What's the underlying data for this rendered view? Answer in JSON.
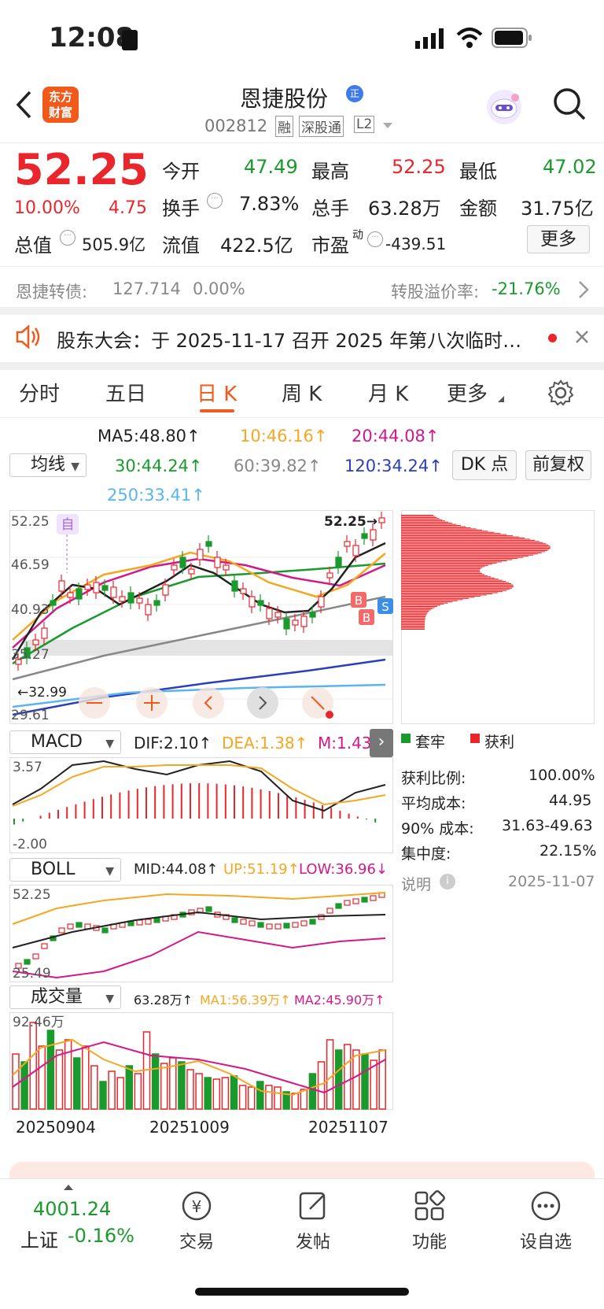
{
  "status": {
    "time": "12:08"
  },
  "header": {
    "logo_line1": "东方",
    "logo_line2": "财富",
    "name": "恩捷股份",
    "badge": "正",
    "code": "002812",
    "tags": [
      "融",
      "深股通",
      "L2"
    ]
  },
  "quote": {
    "price": "52.25",
    "pct": "10.00%",
    "change": "4.75",
    "open_label": "今开",
    "open": "47.49",
    "high_label": "最高",
    "high": "52.25",
    "low_label": "最低",
    "low": "47.02",
    "turnover_label": "换手",
    "turnover": "7.83%",
    "volume_label": "总手",
    "volume": "63.28万",
    "amount_label": "金额",
    "amount": "31.75亿",
    "mcap_label": "总值",
    "mcap": "505.9亿",
    "float_label": "流值",
    "float": "422.5亿",
    "pe_label": "市盈",
    "pe_sup": "动",
    "pe": "-439.51",
    "more": "更多"
  },
  "bond": {
    "label": "恩捷转债:",
    "price": "127.714",
    "pct": "0.00%",
    "premium_label": "转股溢价率:",
    "premium": "-21.76%"
  },
  "notice": {
    "text": "股东大会：于 2025-11-17 召开 2025 年第八次临时…"
  },
  "tabs": [
    "分时",
    "五日",
    "日 K",
    "周 K",
    "月 K",
    "更多"
  ],
  "ma": {
    "selector": "均线",
    "ma5": "MA5:48.80↑",
    "ma10": "10:46.16↑",
    "ma20": "20:44.08↑",
    "ma30": "30:44.24↑",
    "ma60": "60:39.82↑",
    "ma120": "120:34.24↑",
    "ma250": "250:33.41↑",
    "dk": "DK 点",
    "fq": "前复权"
  },
  "kchart": {
    "y_labels": [
      "52.25",
      "46.59",
      "40.93",
      "35.27",
      "29.61"
    ],
    "max_label": "52.25→",
    "min_label": "←32.99",
    "self_tag": "自",
    "b1": "B",
    "b2": "B",
    "s": "S"
  },
  "macd": {
    "selector": "MACD",
    "dif": "DIF:2.10↑",
    "dea": "DEA:1.38↑",
    "m": "M:1.43↑",
    "ymax": "3.57",
    "ymin": "-2.00"
  },
  "boll": {
    "selector": "BOLL",
    "mid": "MID:44.08↑",
    "up": "UP:51.19↑",
    "low": "LOW:36.96↓",
    "ymax": "52.25",
    "ymin": "25.49"
  },
  "vol": {
    "selector": "成交量",
    "vol": "63.28万↑",
    "ma1": "MA1:56.39万↑",
    "ma2": "MA2:45.90万↑",
    "ymax": "92.46万",
    "dates": [
      "20250904",
      "20251009",
      "20251107"
    ]
  },
  "chip": {
    "legend1": "套牢",
    "legend2": "获利",
    "rows": [
      {
        "k": "获利比例:",
        "v": "100.00%"
      },
      {
        "k": "平均成本:",
        "v": "44.95"
      },
      {
        "k": "90% 成本:",
        "v": "31.63-49.63"
      },
      {
        "k": "集中度:",
        "v": "22.15%"
      }
    ],
    "note": "说明",
    "date": "2025-11-07"
  },
  "tabbar": {
    "index_value": "4001.24",
    "index_name": "上证",
    "index_pct": "-0.16%",
    "items": [
      "交易",
      "发帖",
      "功能",
      "设自选"
    ]
  },
  "colors": {
    "up": "#e8262b",
    "down": "#1a9a2c",
    "accent": "#f25a1b"
  }
}
